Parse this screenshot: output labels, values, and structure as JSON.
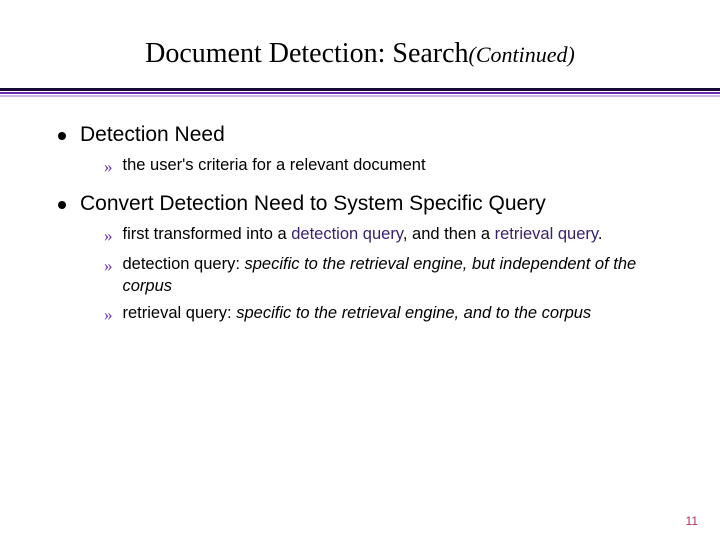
{
  "title_main": "Document Detection: Search",
  "title_cont": "(Continued)",
  "bullets": [
    {
      "label": "Detection Need",
      "subs": [
        {
          "text": "the user's criteria for a relevant document"
        }
      ]
    },
    {
      "label": "Convert Detection Need to System Specific Query",
      "subs": [
        {
          "pre": "first transformed into a ",
          "em1": "detection query",
          "mid": ", and then a ",
          "em2": "retrieval query",
          "post": "."
        },
        {
          "pre": "detection query: ",
          "ital": "specific to the retrieval engine, but independent of the corpus"
        },
        {
          "pre": "retrieval query: ",
          "ital": "specific to the retrieval engine, and to the corpus"
        }
      ]
    }
  ],
  "page_number": "11"
}
